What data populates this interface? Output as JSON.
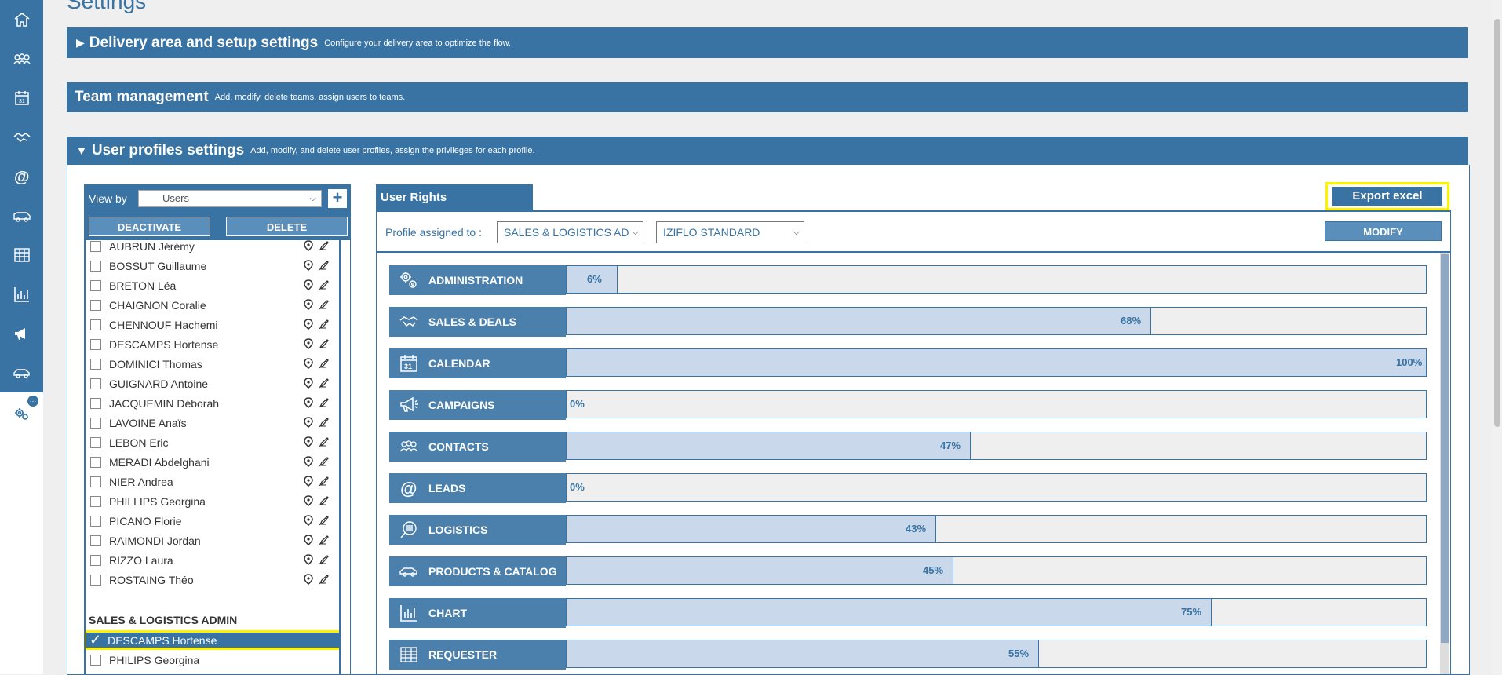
{
  "page": {
    "title": "Settings"
  },
  "nav": {
    "items": [
      {
        "name": "home-icon"
      },
      {
        "name": "contacts-icon"
      },
      {
        "name": "calendar-icon"
      },
      {
        "name": "deals-icon"
      },
      {
        "name": "leads-icon"
      },
      {
        "name": "delivery-truck-icon"
      },
      {
        "name": "table-icon"
      },
      {
        "name": "chart-icon"
      },
      {
        "name": "campaign-icon"
      },
      {
        "name": "car-icon"
      },
      {
        "name": "settings-icon"
      }
    ],
    "settings_badge": "…"
  },
  "sections": {
    "delivery": {
      "title": "Delivery area and setup settings",
      "desc": "Configure your delivery area to optimize the flow."
    },
    "team": {
      "title": "Team management",
      "desc": "Add, modify, delete teams, assign users to teams."
    },
    "profiles": {
      "title": "User profiles settings",
      "desc": "Add, modify, and delete user profiles, assign the privileges for each profile."
    }
  },
  "users_panel": {
    "view_by_label": "View by",
    "view_by_value": "Users",
    "plus": "+",
    "deactivate": "DEACTIVATE",
    "delete": "DELETE",
    "users": [
      "AUBRUN Jérémy",
      "BOSSUT Guillaume",
      "BRETON Léa",
      "CHAIGNON Coralie",
      "CHENNOUF Hachemi",
      "DESCAMPS Hortense",
      "DOMINICI Thomas",
      "GUIGNARD Antoine",
      "JACQUEMIN Déborah",
      "LAVOINE Anaïs",
      "LEBON Eric",
      "MERADI Abdelghani",
      "NIER Andrea",
      "PHILLIPS Georgina",
      "PICANO Florie",
      "RAIMONDI Jordan",
      "RIZZO Laura",
      "ROSTAING Théo"
    ],
    "group_title": "SALES & LOGISTICS ADMIN",
    "group_users": [
      "DESCAMPS Hortense",
      "PHILIPS Georgina"
    ],
    "selected_check": "✓"
  },
  "rights": {
    "tab_label": "User Rights",
    "export_label": "Export excel",
    "profile_label": "Profile assigned to :",
    "profile_value": "SALES & LOGISTICS AD",
    "template_value": "IZIFLO STANDARD",
    "modify_label": "MODIFY",
    "modules": [
      {
        "label": "ADMINISTRATION",
        "pct": 6,
        "pct_label": "6%",
        "icon": "gears-icon"
      },
      {
        "label": "SALES & DEALS",
        "pct": 68,
        "pct_label": "68%",
        "icon": "handshake-icon"
      },
      {
        "label": "CALENDAR",
        "pct": 100,
        "pct_label": "100%",
        "icon": "calendar-icon"
      },
      {
        "label": "CAMPAIGNS",
        "pct": 0,
        "pct_label": "0%",
        "icon": "megaphone-icon"
      },
      {
        "label": "CONTACTS",
        "pct": 47,
        "pct_label": "47%",
        "icon": "contacts-icon"
      },
      {
        "label": "LEADS",
        "pct": 0,
        "pct_label": "0%",
        "icon": "at-icon"
      },
      {
        "label": "LOGISTICS",
        "pct": 43,
        "pct_label": "43%",
        "icon": "barcode-search-icon"
      },
      {
        "label": "PRODUCTS & CATALOG",
        "pct": 45,
        "pct_label": "45%",
        "icon": "car-icon"
      },
      {
        "label": "CHART",
        "pct": 75,
        "pct_label": "75%",
        "icon": "chart-icon"
      },
      {
        "label": "REQUESTER",
        "pct": 55,
        "pct_label": "55%",
        "icon": "table-icon"
      }
    ]
  },
  "colors": {
    "primary": "#3873a3",
    "highlight": "#fff200",
    "bar_fill": "#c9d8ea"
  }
}
